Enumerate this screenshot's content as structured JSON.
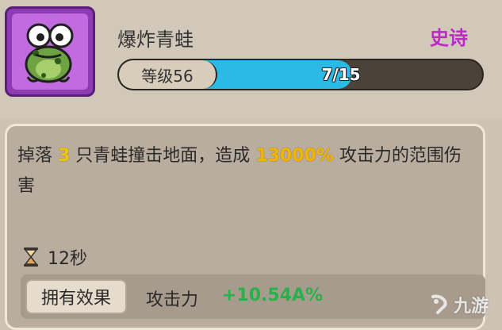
{
  "item": {
    "name": "爆炸青蛙",
    "rarity": "史诗",
    "rarity_color": "#b82cc0",
    "icon": "frog-icon"
  },
  "level": {
    "label": "等级56",
    "progress_text": "7/15",
    "current": 7,
    "max": 15
  },
  "description": {
    "part1": "掉落 ",
    "count": "3",
    "part2": " 只青蛙撞击地面，造成 ",
    "percent": "13000%",
    "part3": " 攻击力的范围伤害"
  },
  "cooldown": {
    "icon": "hourglass-icon",
    "text": "12秒"
  },
  "effect": {
    "tag": "拥有效果",
    "stat": "攻击力",
    "value": "+10.54A%"
  },
  "watermark": {
    "text": "九游"
  }
}
